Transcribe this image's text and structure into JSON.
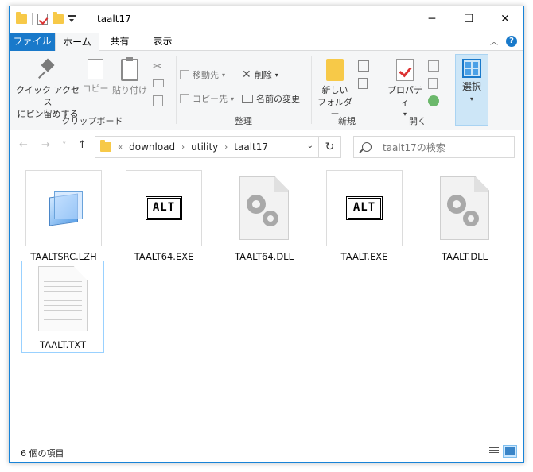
{
  "window": {
    "title": "taalt17",
    "controls": {
      "minimize": "─",
      "maximize": "☐",
      "close": "✕"
    }
  },
  "ribbon_tabs": {
    "file": "ファイル",
    "home": "ホーム",
    "share": "共有",
    "view": "表示",
    "collapse": "︿",
    "help": "?"
  },
  "ribbon": {
    "clipboard": {
      "label": "クリップボード",
      "pin_line1": "クイック アクセス",
      "pin_line2": "にピン留めする",
      "copy": "コピー",
      "paste": "貼り付け"
    },
    "organize": {
      "label": "整理",
      "move_to": "移動先",
      "copy_to": "コピー先",
      "delete": "削除",
      "rename": "名前の変更"
    },
    "new": {
      "label": "新規",
      "new_folder_line1": "新しい",
      "new_folder_line2": "フォルダー"
    },
    "open": {
      "label": "開く",
      "properties": "プロパティ"
    },
    "select": {
      "label": "選択"
    }
  },
  "nav": {
    "back": "←",
    "forward": "→",
    "recent": "˅",
    "up": "↑",
    "breadcrumb_prefix": "«",
    "breadcrumbs": [
      "download",
      "utility",
      "taalt17"
    ],
    "separator": "›",
    "dropdown": "⌄",
    "refresh": "↻",
    "search_placeholder": "taalt17の検索"
  },
  "files": [
    {
      "name": "TAALTSRC.LZH",
      "icon": "archive-cube-icon"
    },
    {
      "name": "TAALT64.EXE",
      "icon": "alt-exe-icon",
      "icon_text": "ALT"
    },
    {
      "name": "TAALT64.DLL",
      "icon": "dll-gear-icon"
    },
    {
      "name": "TAALT.EXE",
      "icon": "alt-exe-icon",
      "icon_text": "ALT"
    },
    {
      "name": "TAALT.DLL",
      "icon": "dll-gear-icon"
    },
    {
      "name": "TAALT.TXT",
      "icon": "text-document-icon"
    }
  ],
  "status": {
    "item_count": "6 個の項目"
  },
  "colors": {
    "accent": "#1979ca",
    "window_border": "#1883d7",
    "folder": "#f7c948",
    "selection_border": "#99d1ff"
  }
}
